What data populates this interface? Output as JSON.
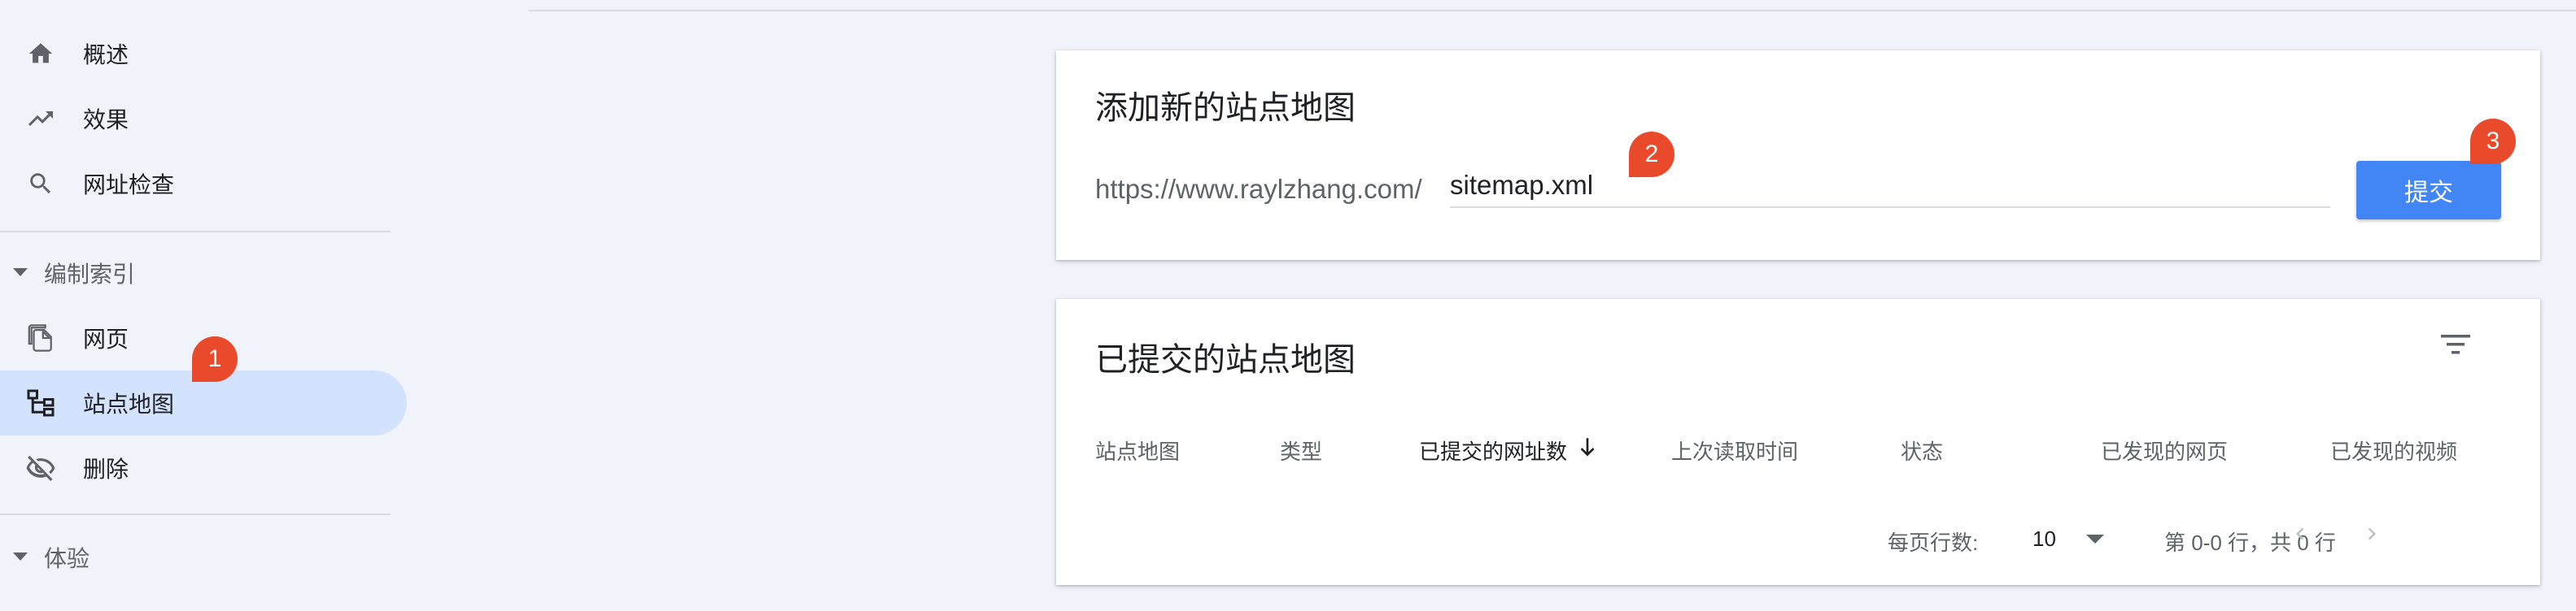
{
  "sidebar": {
    "items": [
      {
        "label": "概述",
        "icon": "home-icon"
      },
      {
        "label": "效果",
        "icon": "trending-up-icon"
      },
      {
        "label": "网址检查",
        "icon": "search-icon"
      }
    ],
    "section_index": {
      "label": "编制索引"
    },
    "index_items": [
      {
        "label": "网页",
        "icon": "pages-icon"
      },
      {
        "label": "站点地图",
        "icon": "sitemap-icon",
        "active": true
      },
      {
        "label": "删除",
        "icon": "eye-off-icon"
      }
    ],
    "section_experience": {
      "label": "体验"
    }
  },
  "add_sitemap": {
    "title": "添加新的站点地图",
    "url_prefix": "https://www.raylzhang.com/",
    "input_value": "sitemap.xml",
    "submit_label": "提交"
  },
  "submitted": {
    "title": "已提交的站点地图",
    "columns": [
      "站点地图",
      "类型",
      "已提交的网址数",
      "上次读取时间",
      "状态",
      "已发现的网页",
      "已发现的视频"
    ],
    "sorted_column": "已提交的网址数",
    "rows_per_page_label": "每页行数:",
    "rows_per_page_value": "10",
    "range_text": "第 0-0 行，共 0 行"
  },
  "badges": [
    "1",
    "2",
    "3"
  ],
  "colors": {
    "accent": "#4285f4",
    "active_nav": "#d3e3fd",
    "badge": "#ea4a2c",
    "background": "#f0f4fa"
  }
}
